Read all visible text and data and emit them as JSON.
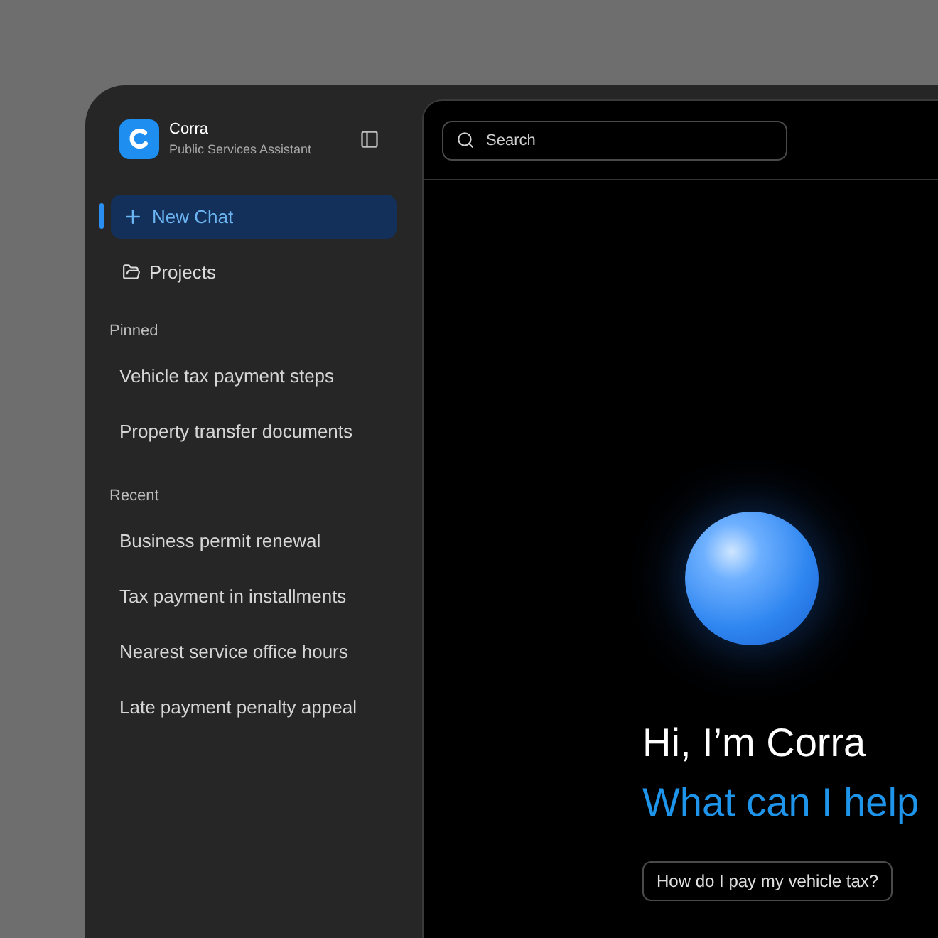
{
  "app": {
    "name": "Corra",
    "subtitle": "Public Services Assistant"
  },
  "nav": [
    {
      "kind": "new",
      "label": "New Chat",
      "selected": true
    },
    {
      "kind": "folder",
      "label": "Projects",
      "selected": false
    }
  ],
  "sections": [
    {
      "title": "Pinned",
      "items": [
        "Vehicle tax payment steps",
        "Property transfer documents"
      ]
    },
    {
      "title": "Recent",
      "items": [
        "Business permit renewal",
        "Tax payment in installments",
        "Nearest service office hours",
        "Late payment penalty appeal"
      ]
    }
  ],
  "search": {
    "placeholder": "Search"
  },
  "greeting": {
    "title": "Hi, I’m Corra",
    "subtitle": "What can I help"
  },
  "suggestions": [
    "How do I pay my vehicle tax?"
  ]
}
